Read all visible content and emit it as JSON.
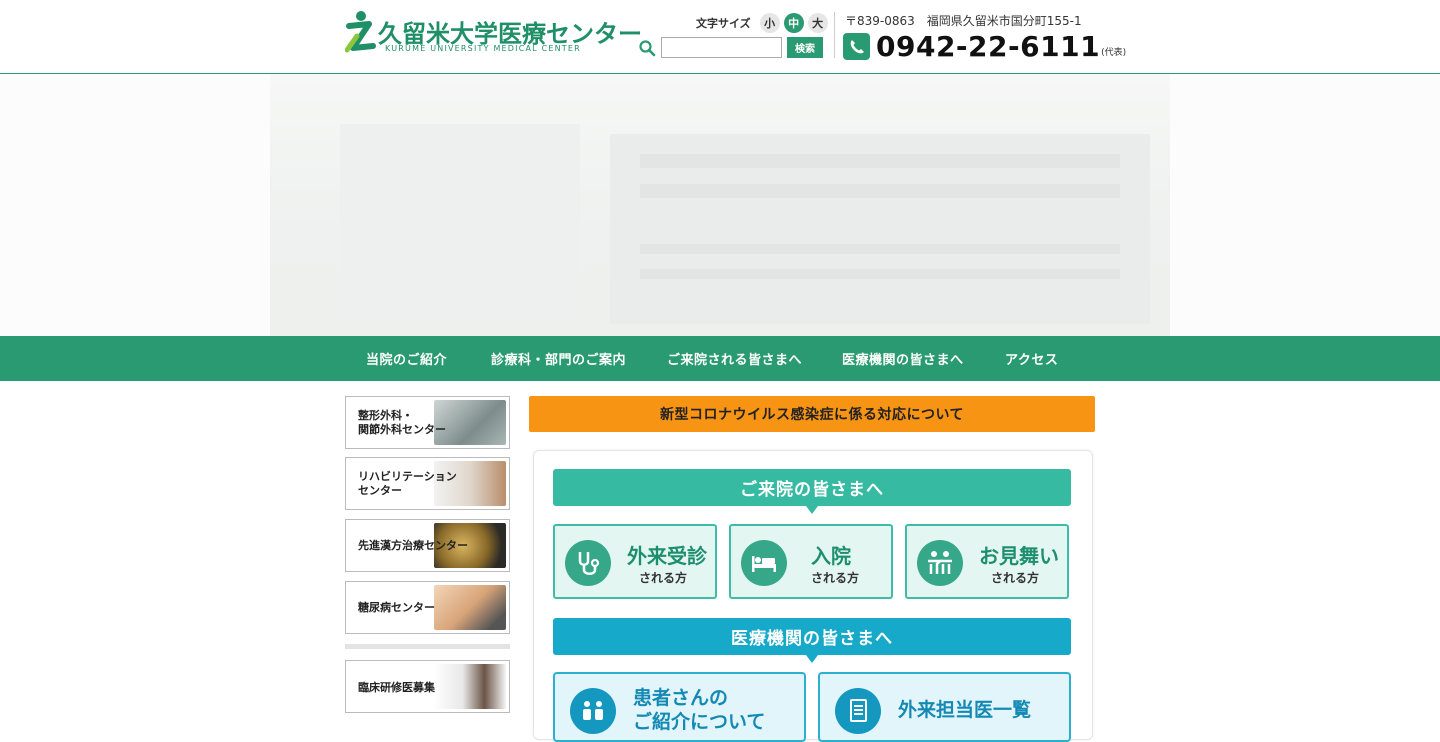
{
  "header": {
    "logo_title": "久留米大学医療センター",
    "logo_sub": "KURUME UNIVERSITY  MEDICAL CENTER",
    "font_size_label": "文字サイズ",
    "font_sizes": [
      "小",
      "中",
      "大"
    ],
    "font_size_selected": "中",
    "search_placeholder": "",
    "search_button": "検索",
    "address": "〒839-0863　福岡県久留米市国分町155-1",
    "phone_number": "0942-22-6111",
    "phone_note": "(代表)"
  },
  "nav": {
    "items": [
      "当院のご紹介",
      "診療科・部門のご案内",
      "ご来院される皆さまへ",
      "医療機関の皆さまへ",
      "アクセス"
    ]
  },
  "sidebar": {
    "banners": [
      {
        "label_line1": "整形外科・",
        "label_line2": "関節外科センター"
      },
      {
        "label_line1": "リハビリテーション",
        "label_line2": "センター"
      },
      {
        "label_line1": "先進漢方治療センター",
        "label_line2": ""
      },
      {
        "label_line1": "糖尿病センター",
        "label_line2": ""
      },
      {
        "label_line1": "臨床研修医募集",
        "label_line2": ""
      }
    ]
  },
  "main": {
    "covid_notice": "新型コロナウイルス感染症に係る対応について",
    "visit_heading": "ご来院の皆さまへ",
    "visit_cards": [
      {
        "title": "外来受診",
        "sub": "される方",
        "icon": "stethoscope-icon"
      },
      {
        "title": "入院",
        "sub": "される方",
        "icon": "bed-icon"
      },
      {
        "title": "お見舞い",
        "sub": "される方",
        "icon": "people-icon"
      }
    ],
    "medical_heading": "医療機関の皆さまへ",
    "medical_cards": [
      {
        "line1": "患者さんの",
        "line2": "ご紹介について",
        "icon": "referral-icon"
      },
      {
        "line1": "外来担当医一覧",
        "line2": "",
        "icon": "document-list-icon"
      }
    ]
  },
  "colors": {
    "brand_green": "#2a9a73",
    "teal": "#36baa2",
    "blue": "#17a9c9",
    "orange": "#f79414"
  }
}
